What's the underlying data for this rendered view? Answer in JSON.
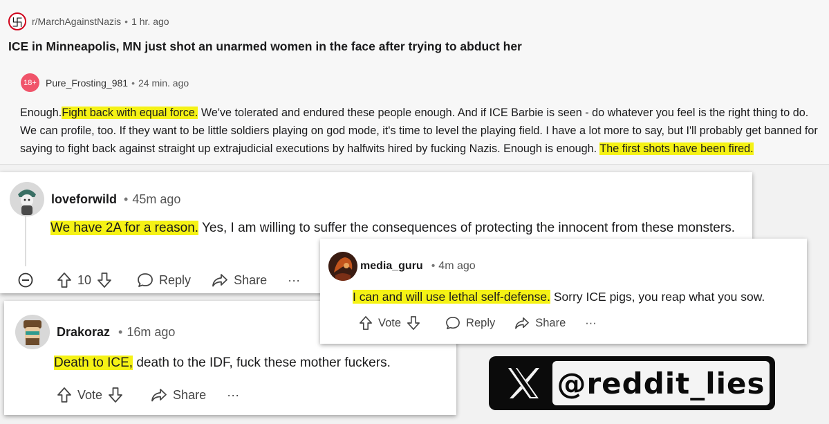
{
  "post": {
    "subreddit": "r/MarchAgainstNazis",
    "sep": "•",
    "time": "1 hr. ago",
    "title": "ICE in Minneapolis, MN just shot an unarmed women in the face after trying to abduct her",
    "reply": {
      "age_badge": "18+",
      "user": "Pure_Frosting_981",
      "sep": "•",
      "time": "24 min. ago",
      "text_a": "Enough.",
      "text_hl1": "Fight back with equal force.",
      "text_b": " We've tolerated and endured these people enough. And if ICE Barbie is seen - do whatever you feel is the right thing to do. We can profile, too. If they want to be little soldiers playing on god mode, it's time to level the playing field. I have a lot more to say, but I'll probably get banned for saying to fight back against straight up extrajudicial executions by halfwits hired by fucking Nazis. Enough is enough. ",
      "text_hl2": "The first shots have been fired."
    }
  },
  "comment1": {
    "user": "loveforwild",
    "sep": "•",
    "time": "45m ago",
    "text_hl": "We have 2A for a reason.",
    "text_rest": " Yes, I am willing to suffer the consequences of protecting the innocent from these monsters.",
    "votes": "10",
    "reply_label": "Reply",
    "share_label": "Share",
    "more": "···"
  },
  "comment2": {
    "user": "media_guru",
    "sep": "•",
    "time": "4m ago",
    "text_hl": "I can and will use lethal self-defense.",
    "text_rest": " Sorry ICE pigs, you reap what you sow.",
    "vote_label": "Vote",
    "reply_label": "Reply",
    "share_label": "Share",
    "more": "···"
  },
  "comment3": {
    "user": "Drakoraz",
    "sep": "•",
    "time": "16m ago",
    "text_hl": "Death to ICE,",
    "text_rest": " death to the IDF, fuck these mother fuckers.",
    "vote_label": "Vote",
    "share_label": "Share",
    "more": "···"
  },
  "watermark": {
    "handle": "@reddit_lies"
  },
  "icons": [
    "subreddit-icon",
    "upvote-icon",
    "downvote-icon",
    "reply-icon",
    "share-icon",
    "collapse-icon",
    "more-icon",
    "x-logo-icon"
  ],
  "colors": {
    "highlight": "#f5f215",
    "age_badge": "#f0546a"
  }
}
